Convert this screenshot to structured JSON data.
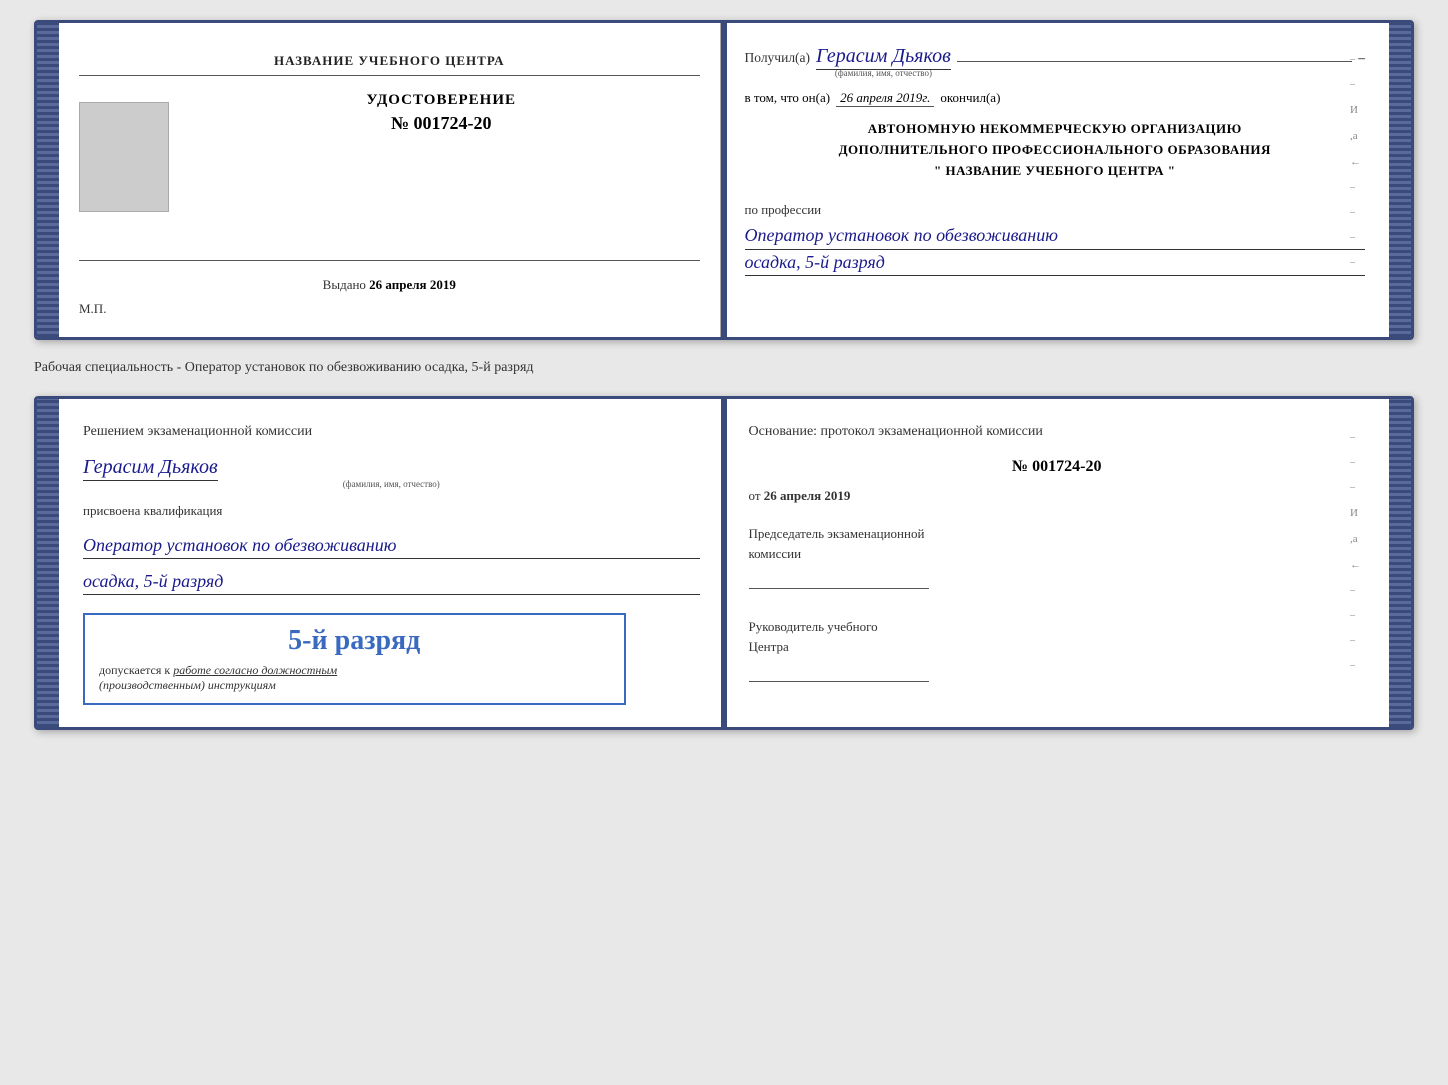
{
  "doc1": {
    "left": {
      "org_name": "НАЗВАНИЕ УЧЕБНОГО ЦЕНТРА",
      "cert_title": "УДОСТОВЕРЕНИЕ",
      "cert_number_prefix": "№",
      "cert_number": "001724-20",
      "issued_label": "Выдано",
      "issued_date": "26 апреля 2019",
      "mp_label": "М.П."
    },
    "right": {
      "received_label": "Получил(а)",
      "recipient_name": "Герасим Дьяков",
      "name_subtitle": "(фамилия, имя, отчество)",
      "date_prefix": "в том, что он(а)",
      "date_value": "26 апреля 2019г.",
      "date_suffix": "окончил(а)",
      "org_line1": "АВТОНОМНУЮ НЕКОММЕРЧЕСКУЮ ОРГАНИЗАЦИЮ",
      "org_line2": "ДОПОЛНИТЕЛЬНОГО ПРОФЕССИОНАЛЬНОГО ОБРАЗОВАНИЯ",
      "org_line3": "\" НАЗВАНИЕ УЧЕБНОГО ЦЕНТРА \"",
      "profession_label": "по профессии",
      "profession_value": "Оператор установок по обезвоживанию",
      "specialty_value": "осадка, 5-й разряд",
      "dash": "–"
    }
  },
  "caption": "Рабочая специальность - Оператор установок по обезвоживанию осадка, 5-й разряд",
  "doc2": {
    "left": {
      "commission_text": "Решением экзаменационной комиссии",
      "person_name": "Герасим Дьяков",
      "name_subtitle": "(фамилия, имя, отчество)",
      "qualification_label": "присвоена квалификация",
      "qualification_value": "Оператор установок по обезвоживанию",
      "qual_specialty": "осадка, 5-й разряд",
      "stamp_rank": "5-й разряд",
      "admitted_label": "допускается к",
      "admitted_text": "работе согласно должностным",
      "admitted_text2": "(производственным) инструкциям"
    },
    "right": {
      "basis_title": "Основание: протокол экзаменационной комиссии",
      "protocol_prefix": "№",
      "protocol_number": "001724-20",
      "date_prefix": "от",
      "date_value": "26 апреля 2019",
      "chairman_label1": "Председатель экзаменационной",
      "chairman_label2": "комиссии",
      "director_label1": "Руководитель учебного",
      "director_label2": "Центра"
    }
  }
}
